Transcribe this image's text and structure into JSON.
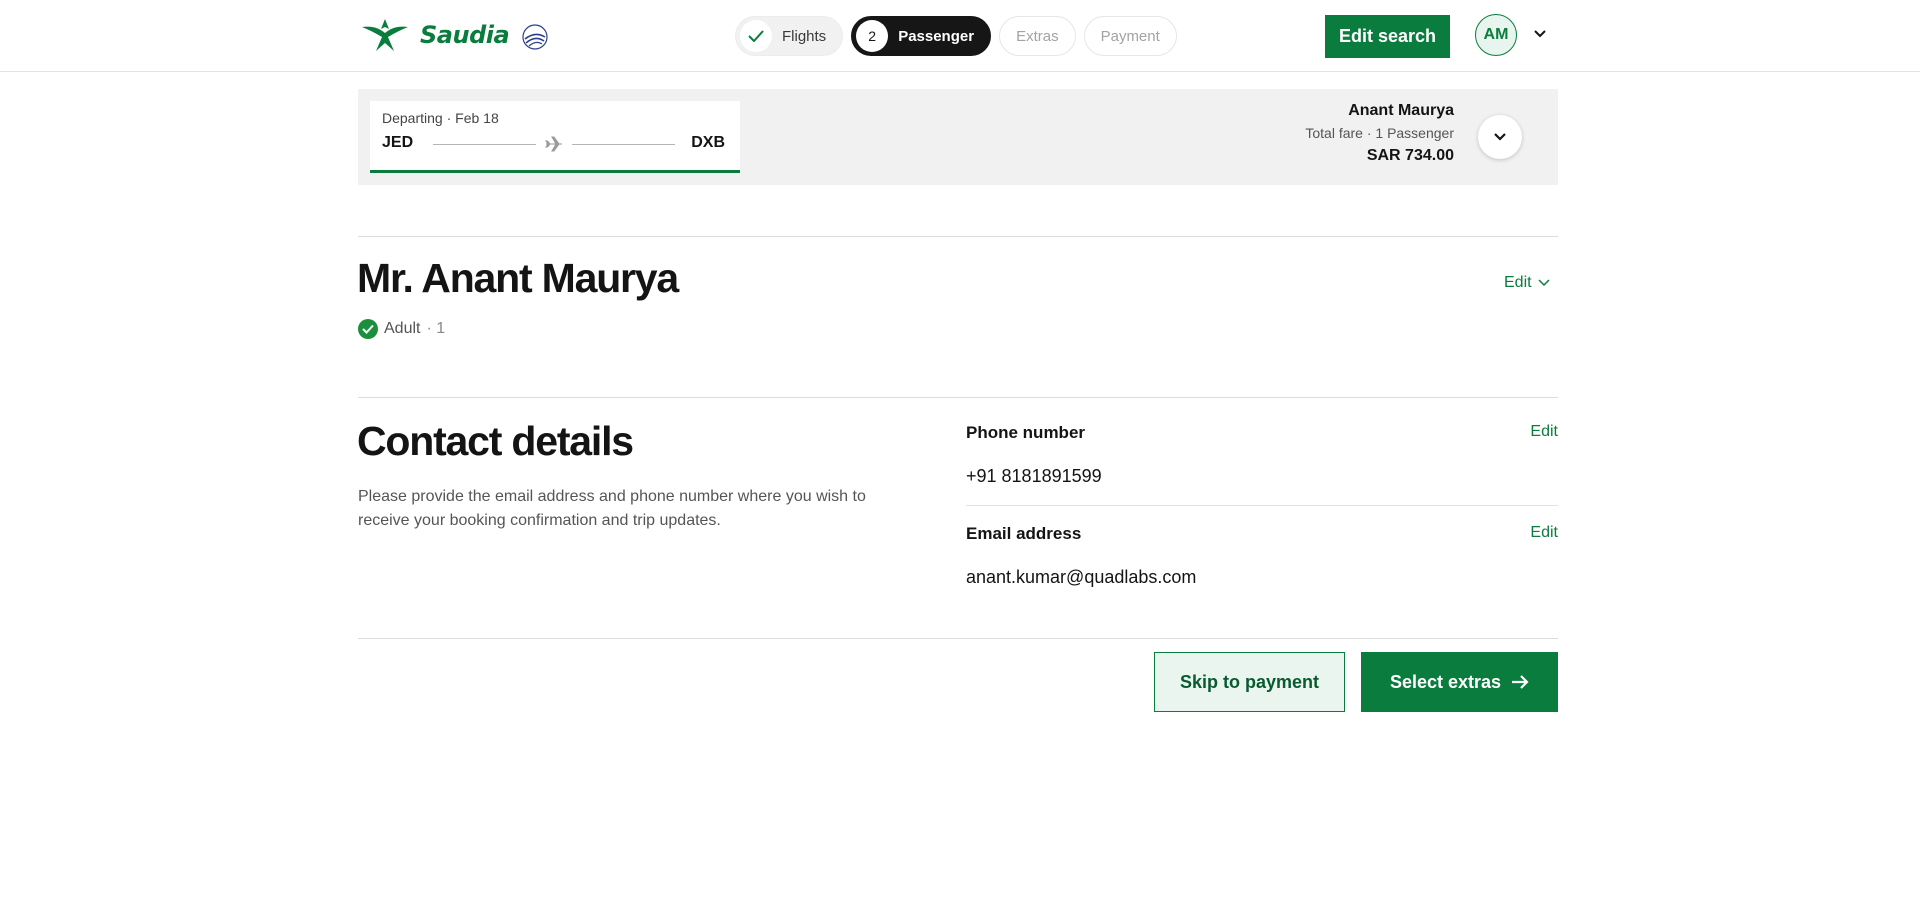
{
  "header": {
    "brand": "Saudia",
    "steps": [
      {
        "label": "Flights",
        "state": "done"
      },
      {
        "label": "Passenger",
        "number": "2",
        "state": "active"
      },
      {
        "label": "Extras",
        "state": "todo"
      },
      {
        "label": "Payment",
        "state": "todo"
      }
    ],
    "edit_search_label": "Edit search",
    "avatar_initials": "AM"
  },
  "summary": {
    "route_date": "Departing · Feb 18",
    "origin": "JED",
    "destination": "DXB",
    "passenger_name": "Anant Maurya",
    "fare_label": "Total fare · 1 Passenger",
    "fare_amount": "SAR 734.00"
  },
  "passenger": {
    "name": "Mr. Anant Maurya",
    "type": "Adult",
    "index": "· 1",
    "edit_label": "Edit"
  },
  "contact": {
    "title": "Contact details",
    "description": "Please provide the email address and phone number where you wish to receive your booking confirmation and trip updates.",
    "phone_label": "Phone number",
    "phone_value": "+91 8181891599",
    "email_label": "Email address",
    "email_value": "anant.kumar@quadlabs.com",
    "edit_label": "Edit"
  },
  "actions": {
    "skip_label": "Skip to payment",
    "extras_label": "Select extras"
  },
  "colors": {
    "brand_green": "#0a7d3e",
    "active_step": "#161616",
    "summary_bg": "#f1f1f1"
  }
}
